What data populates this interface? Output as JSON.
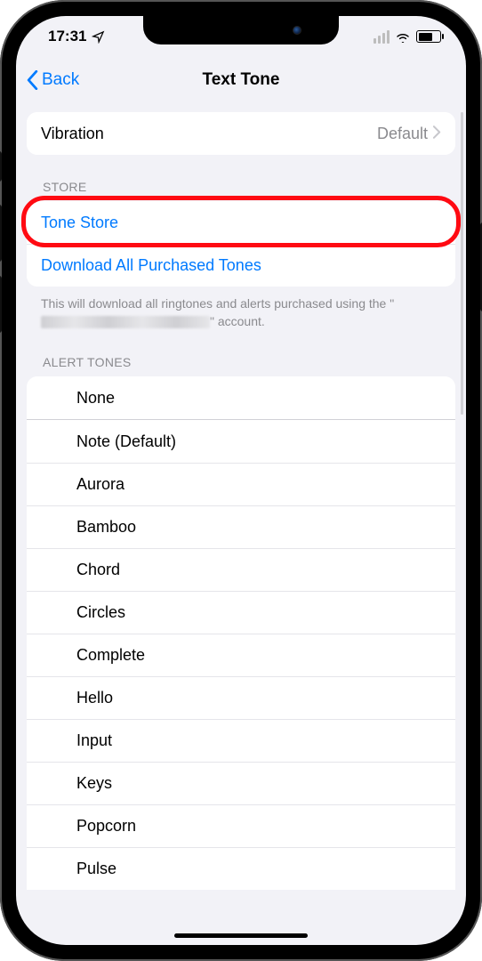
{
  "status": {
    "time": "17:31"
  },
  "nav": {
    "back_label": "Back",
    "title": "Text Tone"
  },
  "vibration": {
    "label": "Vibration",
    "value": "Default"
  },
  "store_section": {
    "header": "STORE",
    "tone_store": "Tone Store",
    "download_all": "Download All Purchased Tones",
    "footer_prefix": "This will download all ringtones and alerts purchased using the \"",
    "footer_suffix": "\" account."
  },
  "alert_section": {
    "header": "ALERT TONES",
    "tones": [
      "None",
      "Note (Default)",
      "Aurora",
      "Bamboo",
      "Chord",
      "Circles",
      "Complete",
      "Hello",
      "Input",
      "Keys",
      "Popcorn",
      "Pulse"
    ]
  },
  "colors": {
    "accent": "#007aff",
    "highlight": "#ff0a12"
  }
}
